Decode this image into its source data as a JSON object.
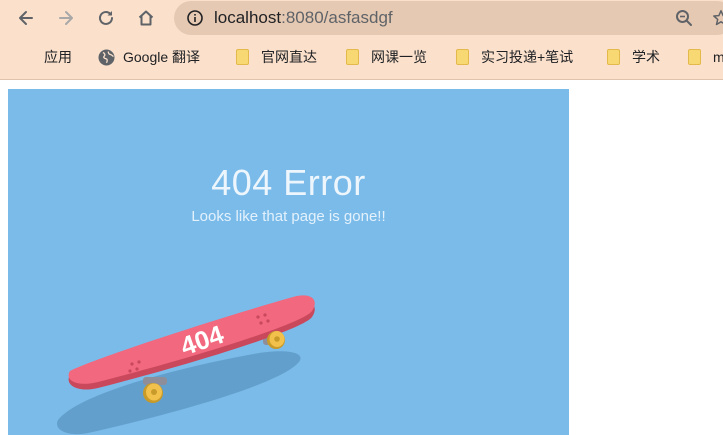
{
  "browser": {
    "url_host": "localhost",
    "url_rest": ":8080/asfasdgf",
    "bookmarks": [
      {
        "label": "应用",
        "icon": "apps-grid-icon"
      },
      {
        "label": "Google 翻译",
        "icon": "globe-icon"
      },
      {
        "label": "官网直达",
        "icon": "folder-icon"
      },
      {
        "label": "网课一览",
        "icon": "folder-icon"
      },
      {
        "label": "实习投递+笔试",
        "icon": "folder-icon"
      },
      {
        "label": "学术",
        "icon": "folder-icon"
      },
      {
        "label": "m",
        "icon": "folder-icon"
      }
    ]
  },
  "page": {
    "title": "404 Error",
    "subtitle": "Looks like that page is gone!!",
    "deck_text": "404",
    "background_color": "#7bbbe9",
    "deck_color": "#f2687e",
    "wheel_color": "#f1c14b"
  }
}
